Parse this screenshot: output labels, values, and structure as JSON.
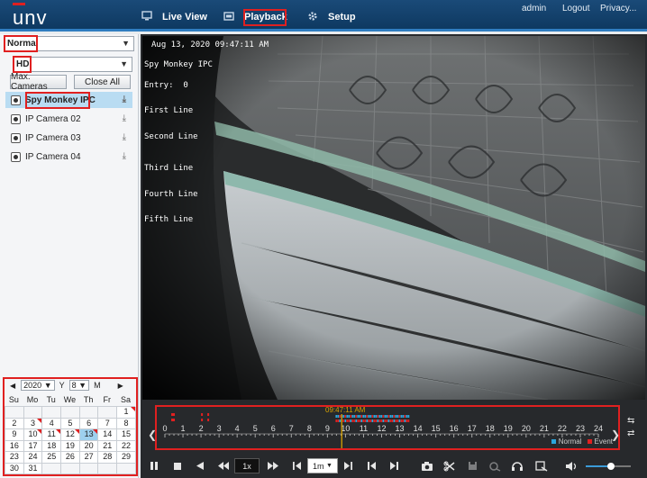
{
  "header": {
    "logo": "unv",
    "nav": [
      {
        "label": "Live View",
        "icon": "monitor-icon"
      },
      {
        "label": "Playback",
        "icon": "playback-icon"
      },
      {
        "label": "Setup",
        "icon": "gear-icon"
      }
    ],
    "user": "admin",
    "logout": "Logout",
    "privacy": "Privacy..."
  },
  "sidebar": {
    "stream_mode": "Normal",
    "quality": "HD",
    "max_cameras": "Max. Cameras",
    "close_all": "Close All",
    "cameras": [
      {
        "name": "Spy Monkey IPC",
        "selected": true
      },
      {
        "name": "IP Camera 02",
        "selected": false
      },
      {
        "name": "IP Camera 03",
        "selected": false
      },
      {
        "name": "IP Camera 04",
        "selected": false
      }
    ]
  },
  "calendar": {
    "year": "2020",
    "year_label": "Y",
    "month": "8",
    "month_label": "M",
    "weekdays": [
      "Su",
      "Mo",
      "Tu",
      "We",
      "Th",
      "Fr",
      "Sa"
    ],
    "lead_blanks": 6,
    "days": 31,
    "selected_day": 13,
    "recorded_days": [
      1,
      3,
      10,
      11,
      12,
      13
    ]
  },
  "video": {
    "timestamp": "Aug 13, 2020 09:47:11 AM",
    "camera_name": "Spy Monkey IPC",
    "entry": "Entry:  0",
    "lines": [
      "First Line",
      "Second Line",
      "Third Line",
      "Fourth Line",
      "Fifth Line"
    ]
  },
  "timeline": {
    "cursor_time": "09:47:11 AM",
    "hours": [
      "0",
      "1",
      "2",
      "3",
      "4",
      "5",
      "6",
      "7",
      "8",
      "9",
      "10",
      "11",
      "12",
      "13",
      "14",
      "15",
      "16",
      "17",
      "18",
      "19",
      "20",
      "21",
      "22",
      "23",
      "24"
    ],
    "cursor_hour": 9.79,
    "legend_normal": "Normal",
    "legend_event": "Event",
    "colors": {
      "normal": "#2aa6dc",
      "event": "#e02020",
      "cursor": "#d9a400"
    }
  },
  "controls": {
    "speed": "1x",
    "step": "1m"
  }
}
